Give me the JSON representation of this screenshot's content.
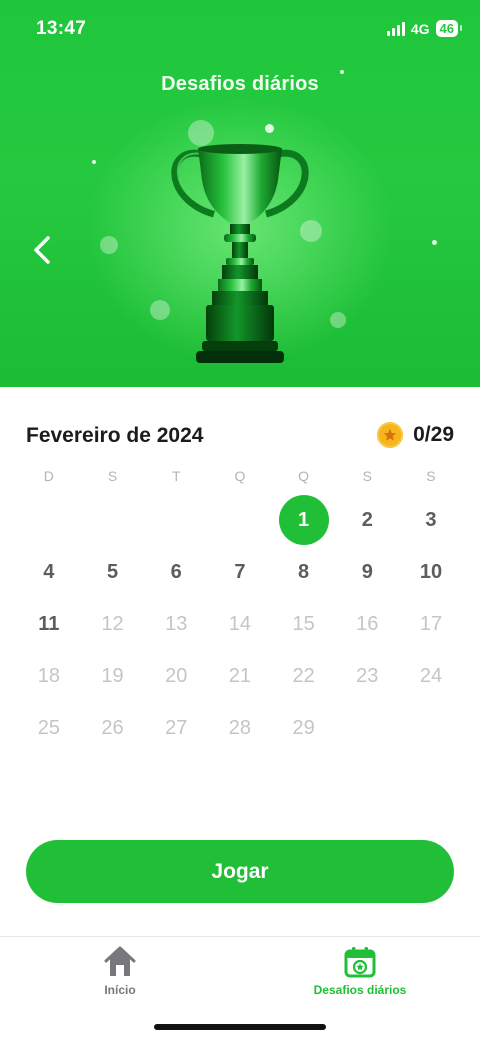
{
  "status_bar": {
    "time": "13:47",
    "network": "4G",
    "battery": "46"
  },
  "header": {
    "title": "Desafios diários"
  },
  "calendar": {
    "month_label": "Fevereiro de 2024",
    "score": "0/29",
    "weekdays": [
      "D",
      "S",
      "T",
      "Q",
      "Q",
      "S",
      "S"
    ],
    "weeks": [
      [
        "",
        "",
        "",
        "",
        "1",
        "2",
        "3"
      ],
      [
        "4",
        "5",
        "6",
        "7",
        "8",
        "9",
        "10"
      ],
      [
        "11",
        "12",
        "13",
        "14",
        "15",
        "16",
        "17"
      ],
      [
        "18",
        "19",
        "20",
        "21",
        "22",
        "23",
        "24"
      ],
      [
        "25",
        "26",
        "27",
        "28",
        "29",
        "",
        ""
      ]
    ],
    "selected_day": "1",
    "last_available_day": 11
  },
  "play_button": {
    "label": "Jogar"
  },
  "tabs": [
    {
      "label": "Início",
      "icon": "home-icon",
      "active": false
    },
    {
      "label": "Desafios diários",
      "icon": "calendar-star-icon",
      "active": true
    }
  ],
  "colors": {
    "accent": "#20bf37",
    "hero_background": "#25c93f",
    "coin": "#f5b51c",
    "active_day": "#5c5c61",
    "future_day": "#c5c5c9"
  }
}
